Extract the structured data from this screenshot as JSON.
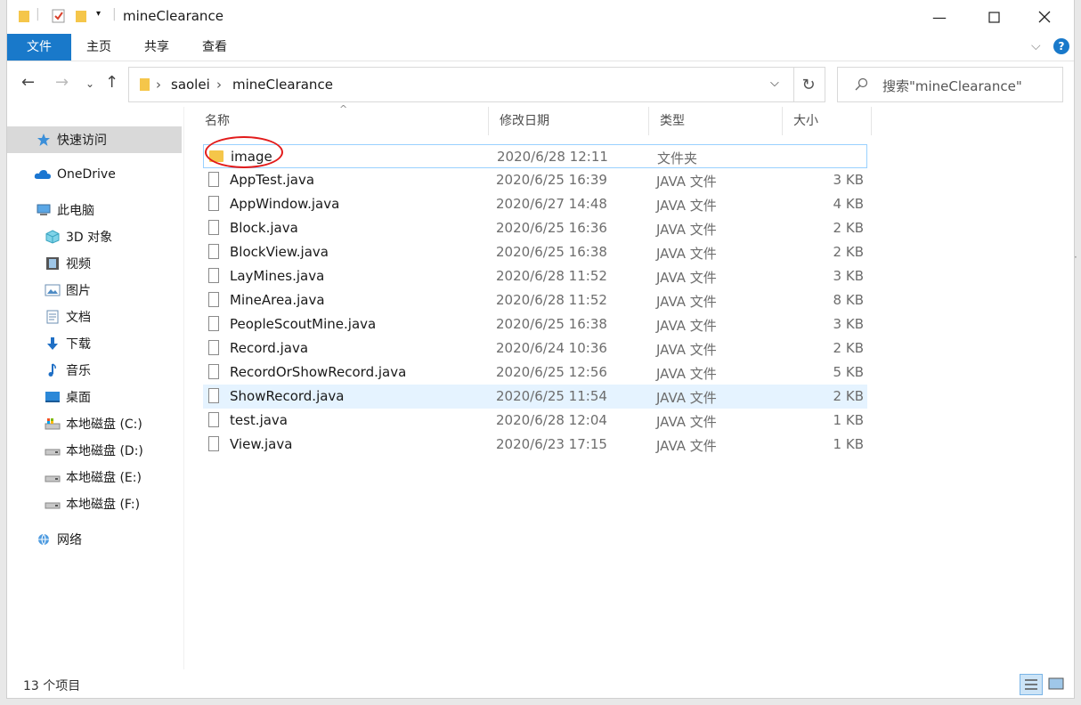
{
  "title": "mineClearance",
  "ribbon": {
    "tabs": [
      "文件",
      "主页",
      "共享",
      "查看"
    ],
    "help": "?"
  },
  "address": {
    "crumbs": [
      "saolei",
      "mineClearance"
    ]
  },
  "search": {
    "placeholder": "搜索\"mineClearance\""
  },
  "sidebar": {
    "items": [
      {
        "label": "快速访问",
        "icon": "star-icon"
      },
      {
        "label": "OneDrive",
        "icon": "cloud-icon"
      },
      {
        "label": "此电脑",
        "icon": "computer-icon"
      },
      {
        "label": "3D 对象",
        "icon": "cube-icon"
      },
      {
        "label": "视频",
        "icon": "film-icon"
      },
      {
        "label": "图片",
        "icon": "picture-icon"
      },
      {
        "label": "文档",
        "icon": "document-icon"
      },
      {
        "label": "下载",
        "icon": "download-icon"
      },
      {
        "label": "音乐",
        "icon": "music-icon"
      },
      {
        "label": "桌面",
        "icon": "desktop-icon"
      },
      {
        "label": "本地磁盘 (C:)",
        "icon": "drive-icon"
      },
      {
        "label": "本地磁盘 (D:)",
        "icon": "drive-icon"
      },
      {
        "label": "本地磁盘 (E:)",
        "icon": "drive-icon"
      },
      {
        "label": "本地磁盘 (F:)",
        "icon": "drive-icon"
      },
      {
        "label": "网络",
        "icon": "network-icon"
      }
    ]
  },
  "columns": {
    "name": "名称",
    "date": "修改日期",
    "type": "类型",
    "size": "大小"
  },
  "files": [
    {
      "name": "image",
      "date": "2020/6/28 12:11",
      "type": "文件夹",
      "size": ""
    },
    {
      "name": "AppTest.java",
      "date": "2020/6/25 16:39",
      "type": "JAVA 文件",
      "size": "3 KB"
    },
    {
      "name": "AppWindow.java",
      "date": "2020/6/27 14:48",
      "type": "JAVA 文件",
      "size": "4 KB"
    },
    {
      "name": "Block.java",
      "date": "2020/6/25 16:36",
      "type": "JAVA 文件",
      "size": "2 KB"
    },
    {
      "name": "BlockView.java",
      "date": "2020/6/25 16:38",
      "type": "JAVA 文件",
      "size": "2 KB"
    },
    {
      "name": "LayMines.java",
      "date": "2020/6/28 11:52",
      "type": "JAVA 文件",
      "size": "3 KB"
    },
    {
      "name": "MineArea.java",
      "date": "2020/6/28 11:52",
      "type": "JAVA 文件",
      "size": "8 KB"
    },
    {
      "name": "PeopleScoutMine.java",
      "date": "2020/6/25 16:38",
      "type": "JAVA 文件",
      "size": "3 KB"
    },
    {
      "name": "Record.java",
      "date": "2020/6/24 10:36",
      "type": "JAVA 文件",
      "size": "2 KB"
    },
    {
      "name": "RecordOrShowRecord.java",
      "date": "2020/6/25 12:56",
      "type": "JAVA 文件",
      "size": "5 KB"
    },
    {
      "name": "ShowRecord.java",
      "date": "2020/6/25 11:54",
      "type": "JAVA 文件",
      "size": "2 KB"
    },
    {
      "name": "test.java",
      "date": "2020/6/28 12:04",
      "type": "JAVA 文件",
      "size": "1 KB"
    },
    {
      "name": "View.java",
      "date": "2020/6/23 17:15",
      "type": "JAVA 文件",
      "size": "1 KB"
    }
  ],
  "status": {
    "count": "13 个项目"
  },
  "colors": {
    "accent": "#1979ca",
    "selection": "#e5f3ff",
    "annotation": "#e21b1b"
  }
}
